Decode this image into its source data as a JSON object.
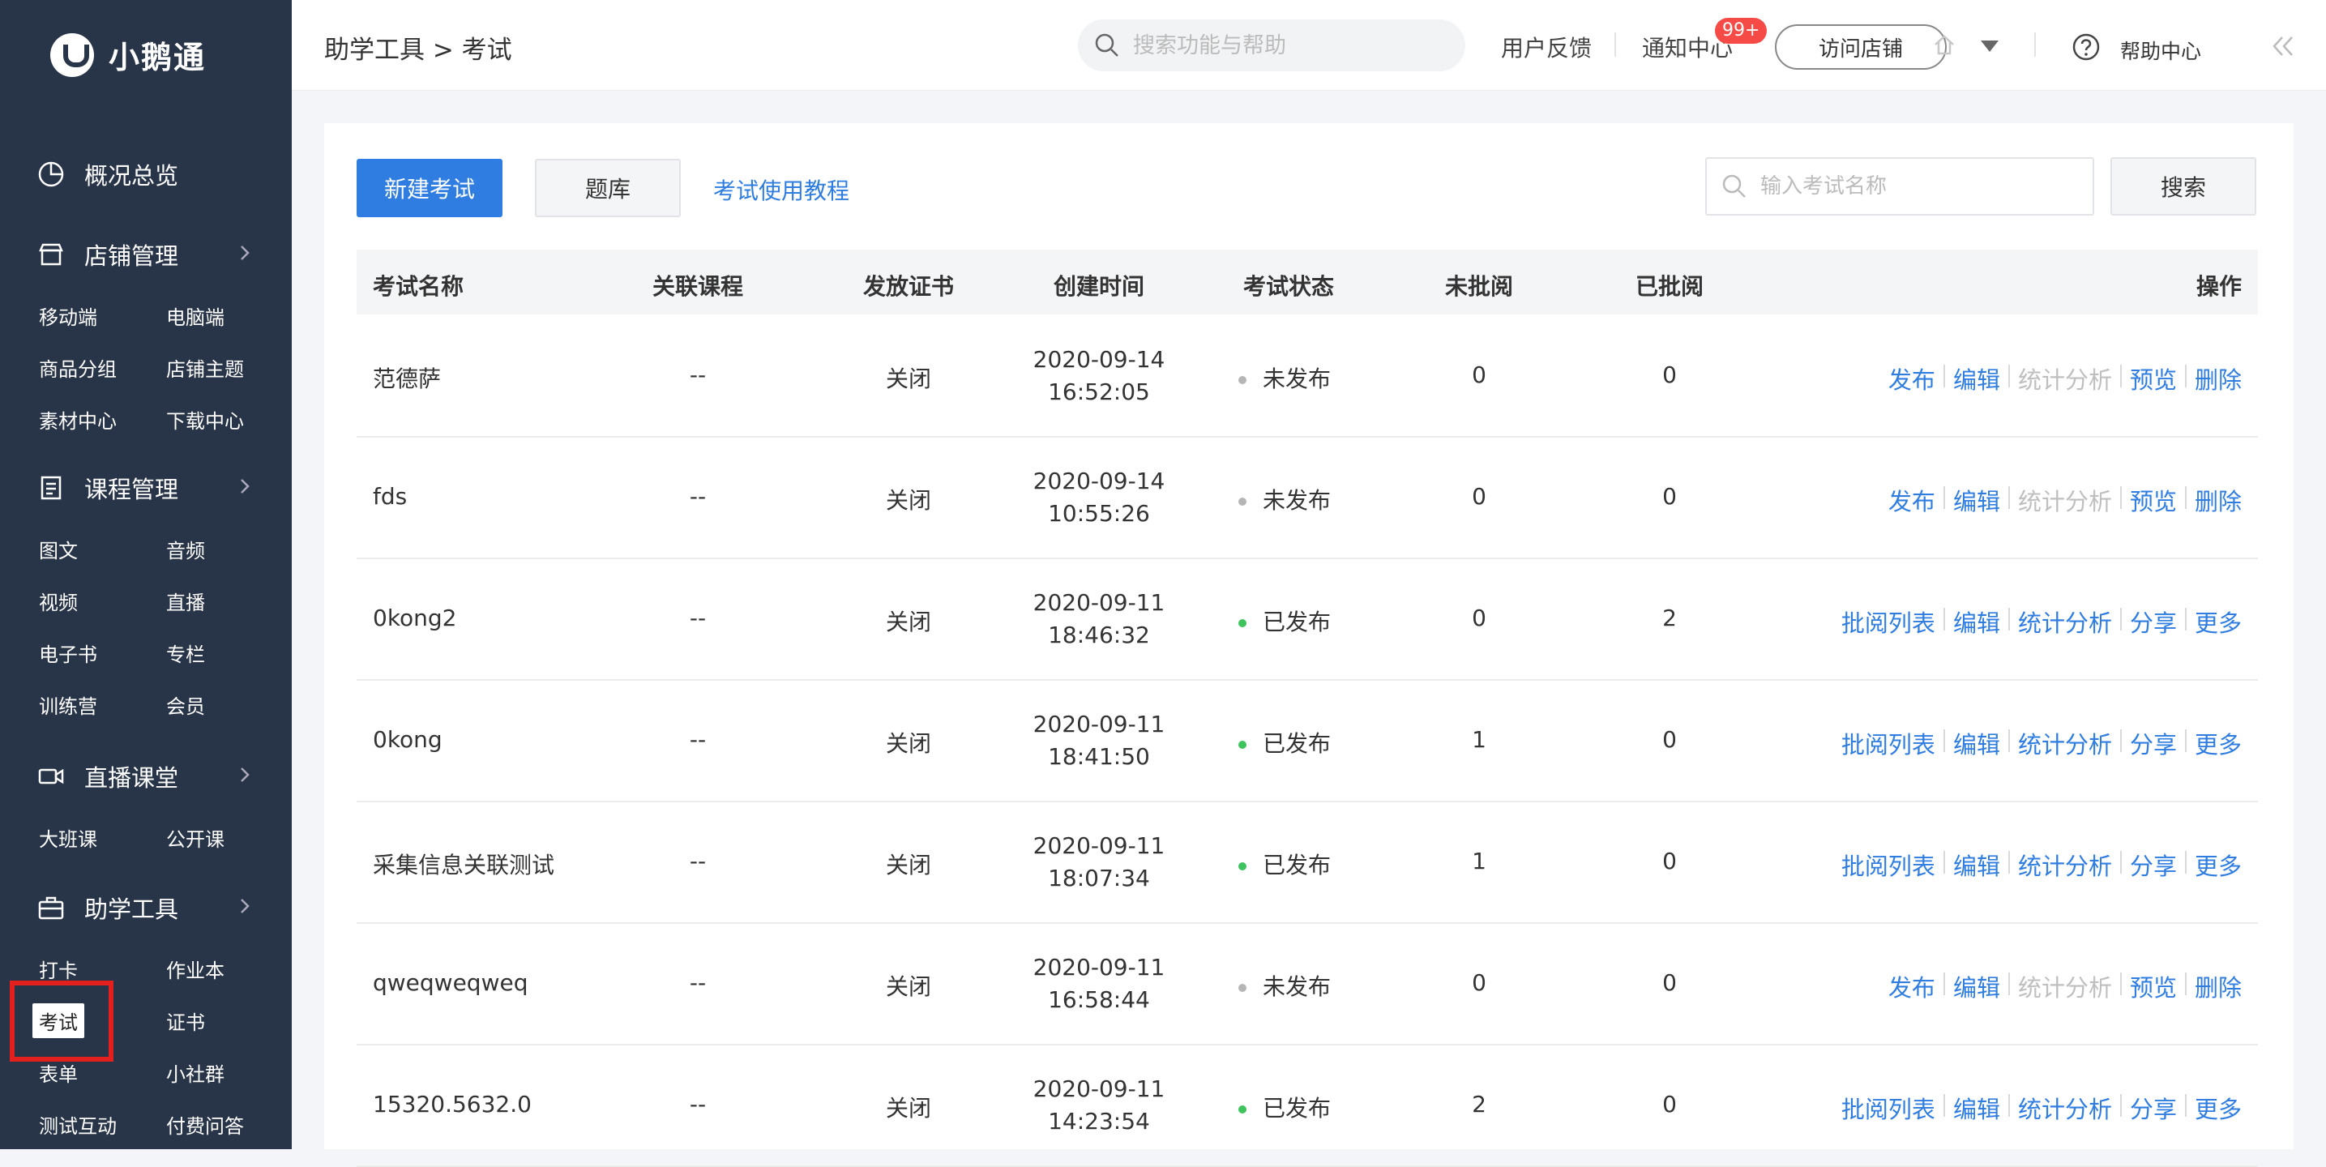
{
  "brand": {
    "name": "小鹅通"
  },
  "sidebar": {
    "sections": [
      {
        "label": "概况总览",
        "icon": "pie-chart-icon",
        "items": []
      },
      {
        "label": "店铺管理",
        "icon": "store-icon",
        "items": [
          "移动端",
          "电脑端",
          "商品分组",
          "店铺主题",
          "素材中心",
          "下载中心"
        ]
      },
      {
        "label": "课程管理",
        "icon": "document-icon",
        "items": [
          "图文",
          "音频",
          "视频",
          "直播",
          "电子书",
          "专栏",
          "训练营",
          "会员"
        ]
      },
      {
        "label": "直播课堂",
        "icon": "video-camera-icon",
        "items": [
          "大班课",
          "公开课"
        ]
      },
      {
        "label": "助学工具",
        "icon": "toolbox-icon",
        "items": [
          "打卡",
          "作业本",
          "考试",
          "证书",
          "表单",
          "小社群",
          "测试互动",
          "付费问答"
        ]
      }
    ],
    "active_item": "考试"
  },
  "topbar": {
    "breadcrumb": "助学工具 > 考试",
    "search_placeholder": "搜索功能与帮助",
    "feedback": "用户反馈",
    "notice": "通知中心",
    "notice_badge": "99+",
    "visit_store": "访问店铺",
    "help": "帮助中心"
  },
  "toolbar": {
    "new_exam": "新建考试",
    "question_bank": "题库",
    "tutorial": "考试使用教程",
    "search_placeholder": "输入考试名称",
    "search_button": "搜索"
  },
  "table": {
    "columns": [
      "考试名称",
      "关联课程",
      "发放证书",
      "创建时间",
      "考试状态",
      "未批阅",
      "已批阅",
      "操作"
    ],
    "rows": [
      {
        "name": "范德萨",
        "course": "--",
        "cert": "关闭",
        "date": "2020-09-14",
        "time": "16:52:05",
        "status": "未发布",
        "unreviewed": "0",
        "reviewed": "0",
        "actions": [
          "发布",
          "编辑",
          "统计分析",
          "预览",
          "删除"
        ]
      },
      {
        "name": "fds",
        "course": "--",
        "cert": "关闭",
        "date": "2020-09-14",
        "time": "10:55:26",
        "status": "未发布",
        "unreviewed": "0",
        "reviewed": "0",
        "actions": [
          "发布",
          "编辑",
          "统计分析",
          "预览",
          "删除"
        ]
      },
      {
        "name": "0kong2",
        "course": "--",
        "cert": "关闭",
        "date": "2020-09-11",
        "time": "18:46:32",
        "status": "已发布",
        "unreviewed": "0",
        "reviewed": "2",
        "actions": [
          "批阅列表",
          "编辑",
          "统计分析",
          "分享",
          "更多"
        ]
      },
      {
        "name": "0kong",
        "course": "--",
        "cert": "关闭",
        "date": "2020-09-11",
        "time": "18:41:50",
        "status": "已发布",
        "unreviewed": "1",
        "reviewed": "0",
        "actions": [
          "批阅列表",
          "编辑",
          "统计分析",
          "分享",
          "更多"
        ]
      },
      {
        "name": "采集信息关联测试",
        "course": "--",
        "cert": "关闭",
        "date": "2020-09-11",
        "time": "18:07:34",
        "status": "已发布",
        "unreviewed": "1",
        "reviewed": "0",
        "actions": [
          "批阅列表",
          "编辑",
          "统计分析",
          "分享",
          "更多"
        ]
      },
      {
        "name": "qweqweqweq",
        "course": "--",
        "cert": "关闭",
        "date": "2020-09-11",
        "time": "16:58:44",
        "status": "未发布",
        "unreviewed": "0",
        "reviewed": "0",
        "actions": [
          "发布",
          "编辑",
          "统计分析",
          "预览",
          "删除"
        ]
      },
      {
        "name": "15320.5632.0",
        "course": "--",
        "cert": "关闭",
        "date": "2020-09-11",
        "time": "14:23:54",
        "status": "已发布",
        "unreviewed": "2",
        "reviewed": "0",
        "actions": [
          "批阅列表",
          "编辑",
          "统计分析",
          "分享",
          "更多"
        ]
      }
    ]
  },
  "colors": {
    "sidebar_bg": "#283447",
    "accent": "#2f7de1",
    "published_dot": "#3fc35e",
    "unpublished_dot": "#b5b5b5",
    "disabled_action": "#bfbfbf",
    "badge": "#f54a45",
    "highlight_box": "#e3201d"
  }
}
